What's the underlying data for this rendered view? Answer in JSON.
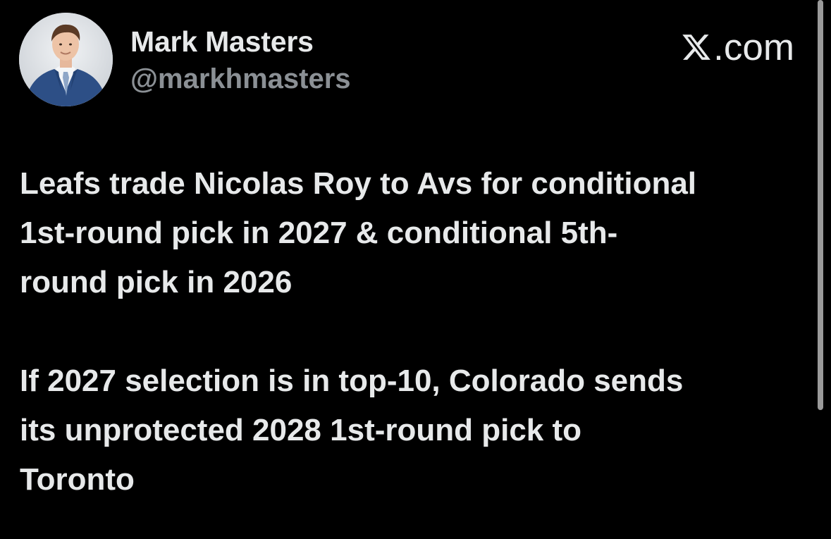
{
  "author": {
    "display_name": "Mark Masters",
    "handle": "@markhmasters",
    "avatar_icon": "profile-photo"
  },
  "brand": {
    "icon": "x-logo-icon",
    "domain": ".com"
  },
  "tweet": {
    "paragraph_1": "Leafs trade Nicolas Roy to Avs for conditional\n1st-round pick in 2027 & conditional 5th-\nround pick in 2026",
    "paragraph_2": "If 2027 selection is in top-10, Colorado sends\nits unprotected 2028 1st-round pick to\nToronto"
  },
  "colors": {
    "background": "#000000",
    "text_primary": "#e7e9ea",
    "text_secondary": "#8b9095"
  }
}
